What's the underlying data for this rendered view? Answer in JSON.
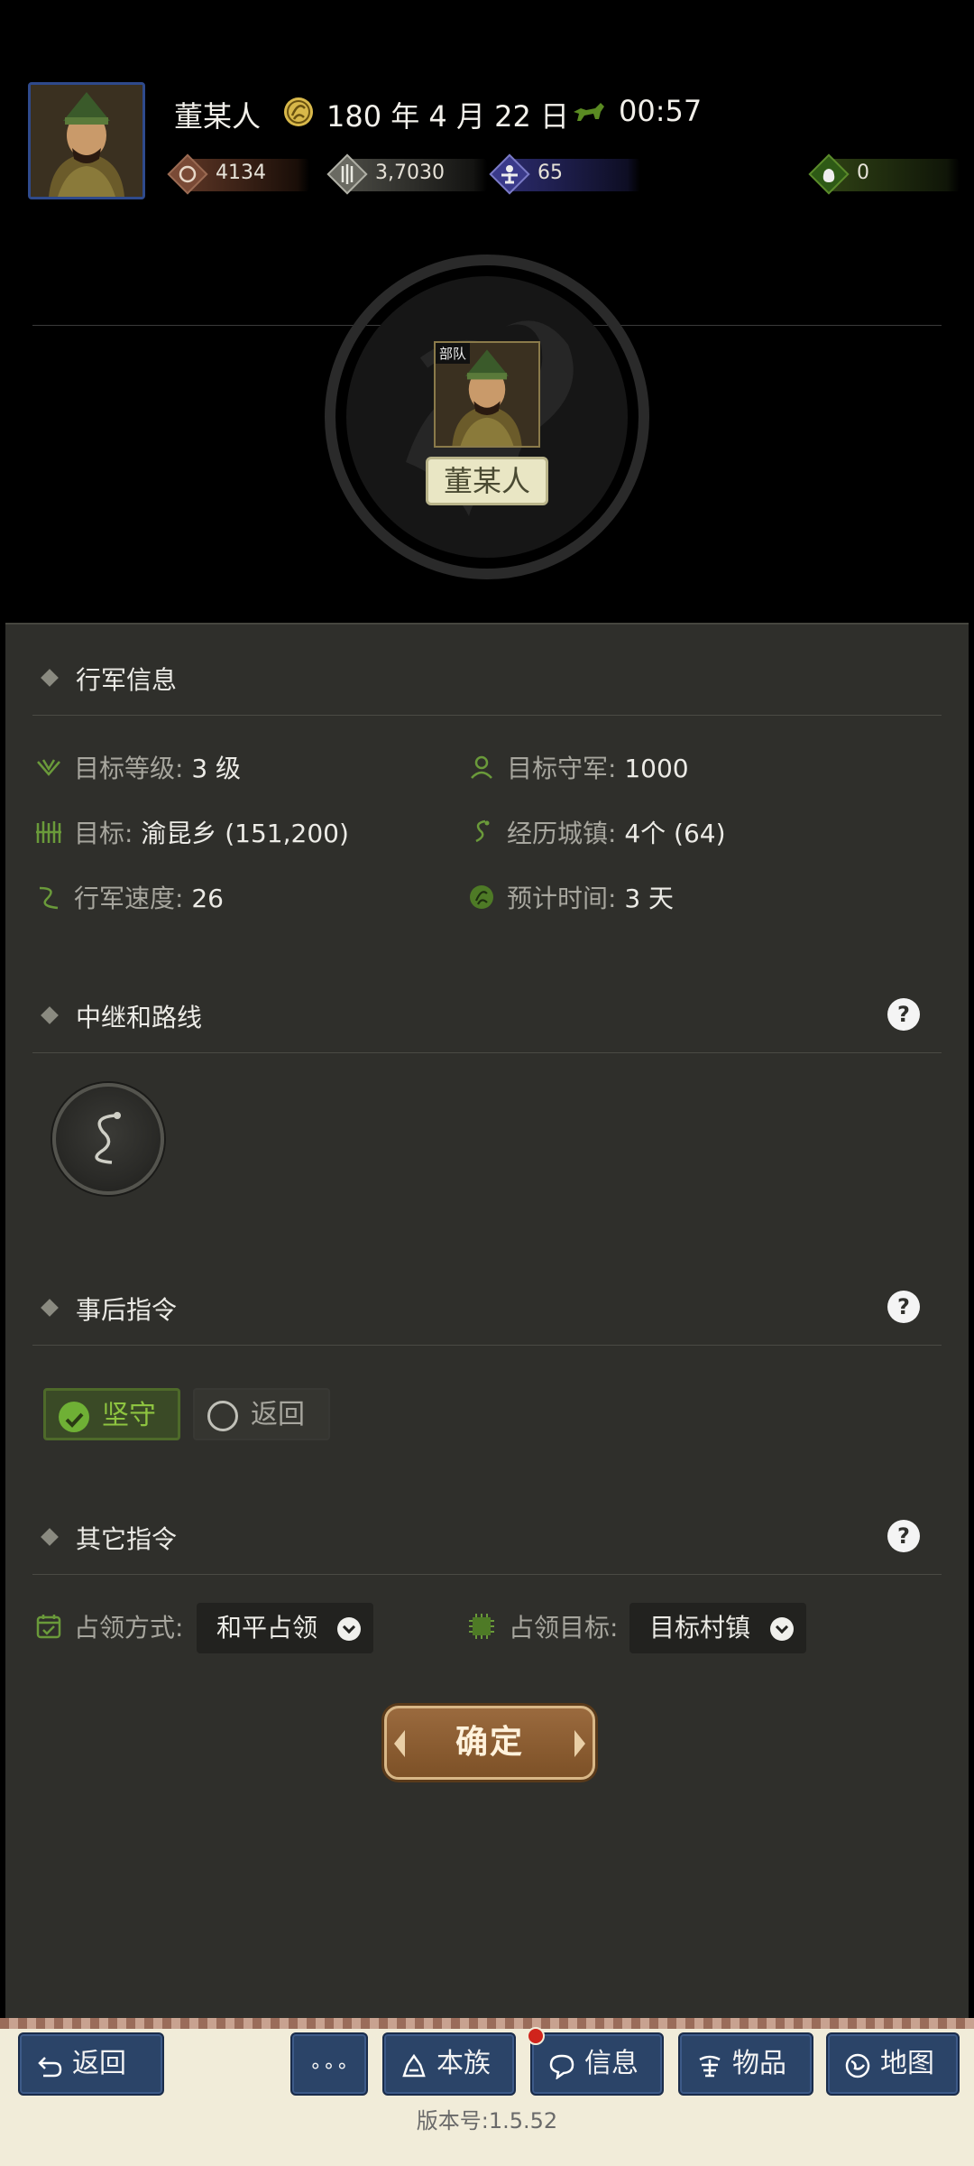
{
  "header": {
    "player_name": "董某人",
    "date": "180 年 4 月 22 日",
    "clock": "00:57",
    "resources": [
      {
        "icon": "coin-icon",
        "value": "4134",
        "color": "#6a3a2a"
      },
      {
        "icon": "grain-icon",
        "value": "3,7030",
        "color": "#5a5a52"
      },
      {
        "icon": "soldier-icon",
        "value": "65",
        "color": "#2e2e6a"
      },
      {
        "icon": "bag-icon",
        "value": "0",
        "color": "#2e3f14"
      }
    ]
  },
  "unit": {
    "tag": "部队",
    "name": "董某人"
  },
  "march_info": {
    "title": "行军信息",
    "target_level_label": "目标等级:",
    "target_level_value": "3 级",
    "target_garrison_label": "目标守军:",
    "target_garrison_value": "1000",
    "target_label": "目标:",
    "target_value": "渝昆乡 (151,200)",
    "towns_label": "经历城镇:",
    "towns_value": "4个 (64)",
    "speed_label": "行军速度:",
    "speed_value": "26",
    "eta_label": "预计时间:",
    "eta_value": "3 天"
  },
  "relay": {
    "title": "中继和路线",
    "help": "?"
  },
  "after_orders": {
    "title": "事后指令",
    "help": "?",
    "options": [
      {
        "label": "坚守",
        "selected": true
      },
      {
        "label": "返回",
        "selected": false
      }
    ]
  },
  "other_orders": {
    "title": "其它指令",
    "help": "?",
    "occupy_method_label": "占领方式:",
    "occupy_method_value": "和平占领",
    "occupy_target_label": "占领目标:",
    "occupy_target_value": "目标村镇"
  },
  "confirm_label": "确定",
  "nav": {
    "back": "返回",
    "more": "∘∘∘",
    "clan": "本族",
    "info": "信息",
    "items": "物品",
    "map": "地图"
  },
  "version": "版本号:1.5.52",
  "colors": {
    "panel_bg": "#2f2f2b",
    "accent_green": "#6fb035",
    "nav_blue": "#2b4468",
    "confirm_brown": "#8a5d33"
  }
}
